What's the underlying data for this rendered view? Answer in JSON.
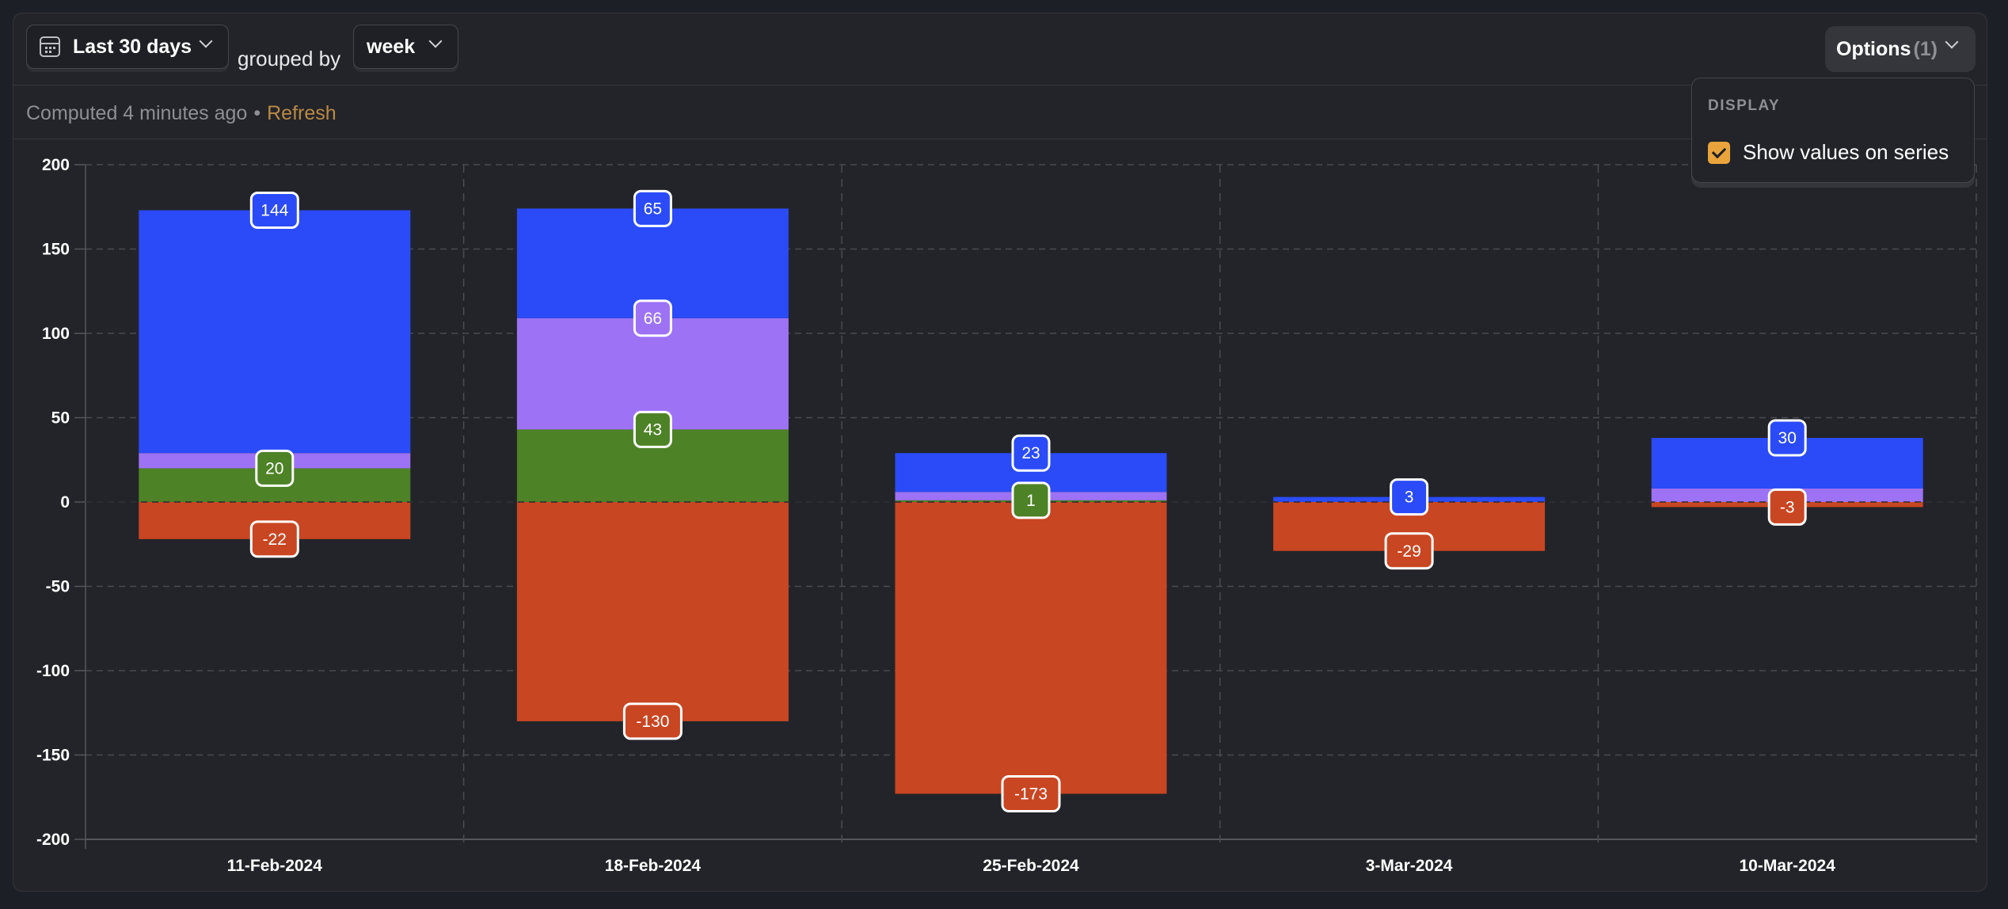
{
  "toolbar": {
    "date_range": "Last 30 days",
    "grouped_by_label": "grouped by",
    "group_value": "week",
    "options_label": "Options",
    "options_count": "(1)"
  },
  "status": {
    "computed": "Computed 4 minutes ago",
    "separator": "•",
    "refresh": "Refresh"
  },
  "popover": {
    "section": "DISPLAY",
    "option_label": "Show values on series",
    "option_checked": true
  },
  "colors": {
    "blue": "#2a4bf7",
    "purple": "#9d72f5",
    "green": "#4d8226",
    "red": "#c94622",
    "accent": "#e9a53c",
    "refresh": "#b98a44"
  },
  "chart_data": {
    "type": "bar",
    "stacked": true,
    "title": "",
    "xlabel": "",
    "ylabel": "",
    "ylim": [
      -200,
      200
    ],
    "yticks": [
      200,
      150,
      100,
      50,
      0,
      -50,
      -100,
      -150,
      -200
    ],
    "grid": true,
    "categories": [
      "11-Feb-2024",
      "18-Feb-2024",
      "25-Feb-2024",
      "3-Mar-2024",
      "10-Mar-2024"
    ],
    "series": [
      {
        "name": "green",
        "color": "#4d8226",
        "values": [
          20,
          43,
          1,
          0,
          0
        ],
        "labels_shown": [
          true,
          true,
          true,
          false,
          false
        ]
      },
      {
        "name": "purple",
        "color": "#9d72f5",
        "values": [
          9,
          66,
          5,
          0,
          8
        ],
        "labels_shown": [
          false,
          true,
          false,
          false,
          false
        ]
      },
      {
        "name": "blue",
        "color": "#2a4bf7",
        "values": [
          144,
          65,
          23,
          3,
          30
        ],
        "labels_shown": [
          true,
          true,
          true,
          true,
          true
        ]
      },
      {
        "name": "red",
        "color": "#c94622",
        "values": [
          -22,
          -130,
          -173,
          -29,
          -3
        ],
        "labels_shown": [
          true,
          true,
          true,
          true,
          true
        ]
      }
    ]
  }
}
